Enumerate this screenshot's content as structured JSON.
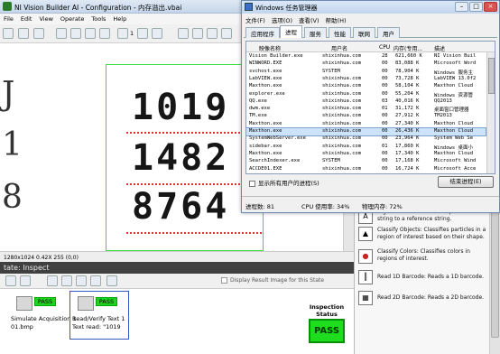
{
  "vb": {
    "title": "NI Vision Builder AI - Configuration - 内存溢出.vbai",
    "menu": [
      "File",
      "Edit",
      "View",
      "Operate",
      "Tools",
      "Help"
    ],
    "toolbar_counter": "1",
    "image_digits": [
      "1019",
      "1482",
      "8764"
    ],
    "image_status": "1280x1024 0.42X 255   (0,0)",
    "state_label": "tate:  Inspect",
    "display_result_label": "Display Result Image for this State",
    "steps": [
      {
        "name": "Simulate Acquisition 1",
        "line2": "01.bmp",
        "status": "PASS"
      },
      {
        "name": "Read/Verify Text 1",
        "line2": "Text read: \"1019",
        "status": "PASS"
      }
    ],
    "inspection_status_label": "Inspection Status",
    "inspection_status_value": "PASS",
    "palette": [
      {
        "icon": "ocr-icon",
        "text": "region of interest and compares the read string to a reference string."
      },
      {
        "icon": "classify-objects-icon",
        "text": "Classify Objects: Classifies particles in a region of interest based on their shape."
      },
      {
        "icon": "classify-colors-icon",
        "text": "Classify Colors: Classifies colors in regions of interest."
      },
      {
        "icon": "barcode-1d-icon",
        "text": "Read 1D Barcode: Reads a 1D barcode."
      },
      {
        "icon": "barcode-2d-icon",
        "text": "Read 2D Barcode: Reads a 2D barcode."
      }
    ]
  },
  "tm": {
    "title": "Windows 任务管理器",
    "menu": [
      "文件(F)",
      "选项(O)",
      "查看(V)",
      "帮助(H)"
    ],
    "tabs": [
      "应用程序",
      "进程",
      "服务",
      "性能",
      "联网",
      "用户"
    ],
    "active_tab": "进程",
    "columns": [
      "映像名称",
      "用户名",
      "CPU",
      "内存(专用...",
      "描述"
    ],
    "rows": [
      [
        "Vision Builder.exe",
        "shixinhua.com",
        "28",
        "621,660 K",
        "NI Vision Buil"
      ],
      [
        "WINWORD.EXE",
        "shixinhua.com",
        "00",
        "83,088 K",
        "Microsoft Word"
      ],
      [
        "svchost.exe",
        "SYSTEM",
        "00",
        "78,904 K",
        "Windows 服务主"
      ],
      [
        "LabVIEW.exe",
        "shixinhua.com",
        "00",
        "73,728 K",
        "LabVIEW 13.0f2"
      ],
      [
        "Maxthon.exe",
        "shixinhua.com",
        "00",
        "58,104 K",
        "Maxthon Cloud"
      ],
      [
        "explorer.exe",
        "shixinhua.com",
        "00",
        "55,204 K",
        "Windows 资源管"
      ],
      [
        "QQ.exe",
        "shixinhua.com",
        "03",
        "40,016 K",
        "QQ2013"
      ],
      [
        "dwm.exe",
        "shixinhua.com",
        "01",
        "31,172 K",
        "桌面窗口管理器"
      ],
      [
        "TM.exe",
        "shixinhua.com",
        "00",
        "27,912 K",
        "TM2013"
      ],
      [
        "Maxthon.exe",
        "shixinhua.com",
        "00",
        "27,340 K",
        "Maxthon Cloud"
      ],
      [
        "Maxthon.exe",
        "shixinhua.com",
        "00",
        "26,436 K",
        "Maxthon Cloud"
      ],
      [
        "SystemWebServer.exe",
        "shixinhua.com",
        "00",
        "23,964 K",
        "System Web Se"
      ],
      [
        "sidebar.exe",
        "shixinhua.com",
        "01",
        "17,860 K",
        "Windows 桌面小"
      ],
      [
        "Maxthon.exe",
        "shixinhua.com",
        "00",
        "17,340 K",
        "Maxthon Cloud"
      ],
      [
        "SearchIndexer.exe",
        "SYSTEM",
        "00",
        "17,168 K",
        "Microsoft Wind"
      ],
      [
        "ACCDE01.EXE",
        "shixinhua.com",
        "00",
        "16,724 K",
        "Microsoft Acce"
      ]
    ],
    "selected_row": 10,
    "show_all_label": "显示所有用户的进程(S)",
    "end_process_label": "结束进程(E)",
    "status": {
      "processes": "进程数: 81",
      "cpu": "CPU 使用率: 34%",
      "memory": "物理内存: 72%"
    }
  }
}
